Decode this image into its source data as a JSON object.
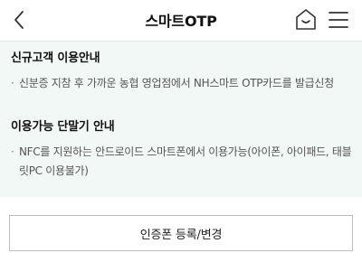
{
  "header": {
    "title": "스마트OTP",
    "back_icon": "chevron-left-icon",
    "home_icon": "home-icon",
    "menu_icon": "hamburger-menu-icon"
  },
  "notices": [
    {
      "title": "신규고객 이용안내",
      "items": [
        "신분증 지참 후 가까운 농협 영업점에서 NH스마트 OTP카드를 발급신청"
      ]
    },
    {
      "title": "이용가능 단말기 안내",
      "items": [
        "NFC를 지원하는 안드로이드 스마트폰에서 이용가능(아이폰, 아이패드, 태블릿PC 이용불가)"
      ]
    }
  ],
  "actions": {
    "register_label": "인증폰 등록/변경"
  },
  "colors": {
    "notice_background": "#f2f8f5",
    "button_border": "#bdbdbd"
  }
}
